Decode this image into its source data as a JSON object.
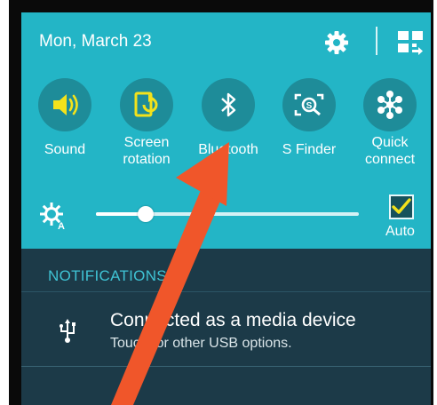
{
  "status": {
    "date": "Mon, March 23"
  },
  "toggles": [
    {
      "label": "Sound",
      "icon": "sound-icon"
    },
    {
      "label": "Screen\nrotation",
      "icon": "screen-rotation-icon"
    },
    {
      "label": "Bluetooth",
      "icon": "bluetooth-icon"
    },
    {
      "label": "S Finder",
      "icon": "s-finder-icon"
    },
    {
      "label": "Quick\nconnect",
      "icon": "quick-connect-icon"
    }
  ],
  "brightness": {
    "level": 0.19,
    "auto_label": "Auto",
    "auto_checked": true
  },
  "notifications": {
    "header": "NOTIFICATIONS",
    "items": [
      {
        "title": "Connected as a media device",
        "subtitle": "Touch for other USB options.",
        "icon": "usb-icon"
      }
    ]
  },
  "colors": {
    "panel": "#23b5c6",
    "toggle_circle": "#1e8c99",
    "shade": "#1c3a48",
    "accent_text": "#3fc3d4",
    "sound_icon": "#f3e21b",
    "rotation_icon": "#f3e21b",
    "checkmark": "#f3e21b",
    "arrow": "#f0562a"
  }
}
